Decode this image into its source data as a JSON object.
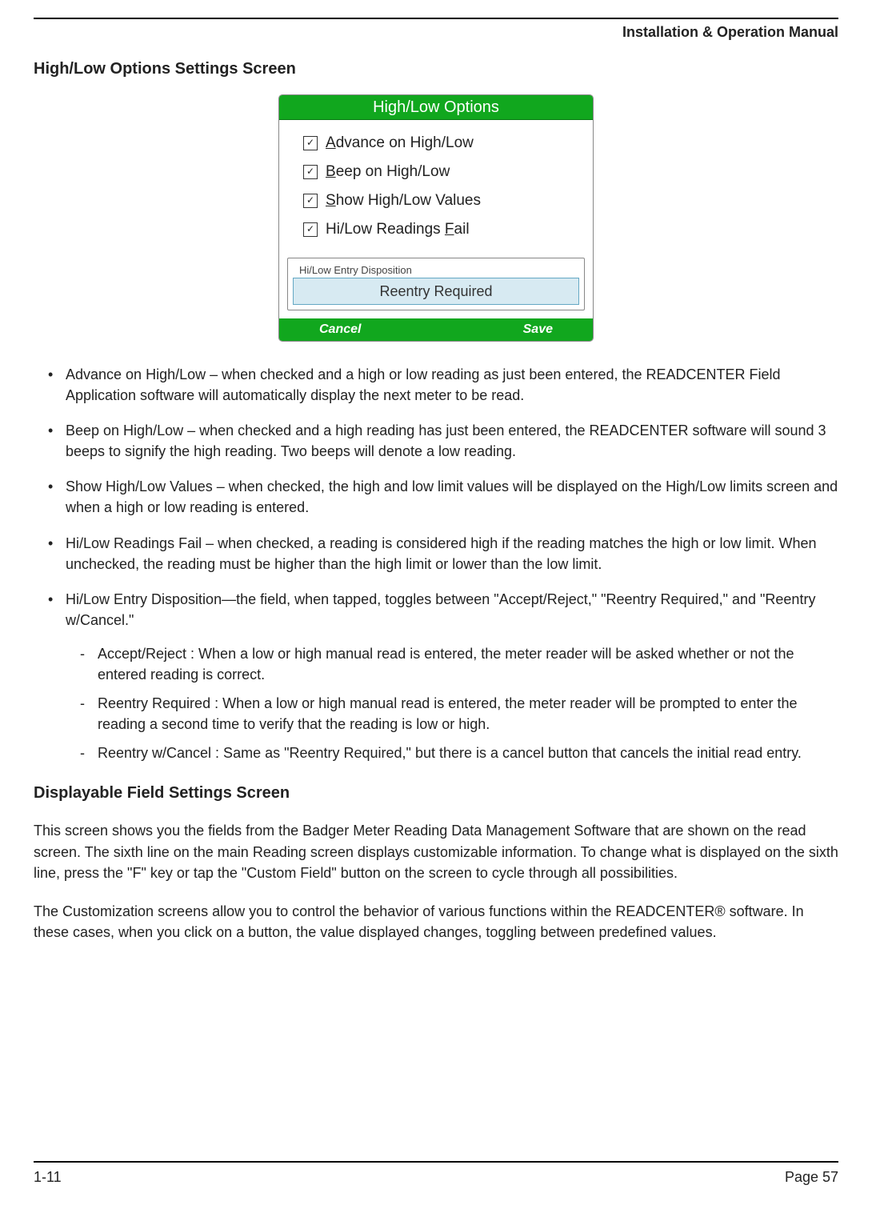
{
  "header": {
    "doc_title": "Installation & Operation Manual"
  },
  "section1": {
    "heading": "High/Low Options Settings Screen"
  },
  "panel": {
    "title": "High/Low Options",
    "checkbox1_pre": "A",
    "checkbox1_rest": "dvance on High/Low",
    "checkbox2_pre": "B",
    "checkbox2_rest": "eep on High/Low",
    "checkbox3_pre": "S",
    "checkbox3_rest": "how High/Low Values",
    "checkbox4a": "Hi/Low Readings ",
    "checkbox4_pre": "F",
    "checkbox4_rest": "ail",
    "fs_legend": "Hi/Low Entry Disposition",
    "disposition_value": "Reentry Required",
    "btn_cancel": "Cancel",
    "btn_save": "Save"
  },
  "bullets": {
    "b1": "Advance on High/Low – when checked and a high or low reading as just been entered, the READCENTER Field Application software will automatically display the next meter to be read.",
    "b2": "Beep on High/Low – when checked and a high reading has just been entered, the READCENTER software will sound 3 beeps to signify the high reading.  Two beeps will denote a low reading.",
    "b3": "Show High/Low Values – when checked, the high and low limit values will be displayed on the High/Low limits screen and when a high or low reading is entered.",
    "b4": "Hi/Low Readings Fail – when checked, a reading is considered high if the reading matches the high or low limit.  When unchecked, the reading must be higher than the high limit or lower than the low limit.",
    "b5": "Hi/Low Entry Disposition—the field, when tapped, toggles between \"Accept/Reject,\" \"Reentry Required,\" and \"Reentry w/Cancel.\"",
    "d1": "Accept/Reject : When a low or high manual read is entered, the meter reader will be asked whether or not the entered reading is correct.",
    "d2": "Reentry Required : When a low or high manual read is entered, the meter reader will be prompted to enter the reading a second time to verify that the reading is low or high.",
    "d3": "Reentry w/Cancel : Same as \"Reentry Required,\" but there is a cancel button that cancels the initial read entry."
  },
  "section2": {
    "heading": "Displayable Field Settings Screen",
    "p1": "This screen shows you the fields from the Badger Meter Reading Data Management Software that are shown on the read screen.  The sixth line on the main Reading screen displays customizable information.  To change what is displayed on the sixth line, press the \"F\" key or tap the \"Custom Field\" button on the screen to cycle through all possibilities.",
    "p2": "The Customization screens allow you to control the behavior of various functions within the READCENTER® software.  In these cases, when you click on a button, the value displayed changes, toggling between predefined values."
  },
  "footer": {
    "left": "1-11",
    "right": "Page 57"
  }
}
